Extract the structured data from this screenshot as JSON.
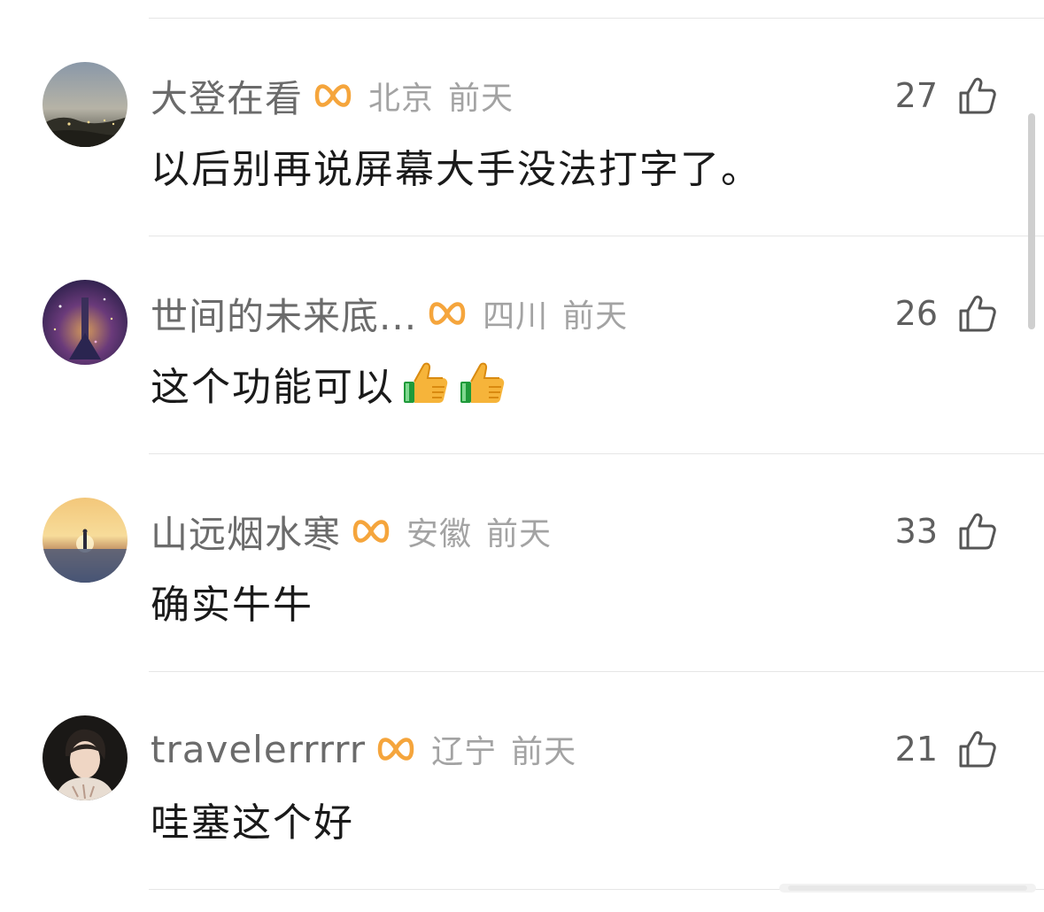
{
  "comments": [
    {
      "username": "大登在看",
      "location": "北京",
      "time": "前天",
      "likes": "27",
      "text": "以后别再说屏幕大手没法打字了。",
      "emoji_count": 0,
      "avatar_icon": "city-night-avatar-icon"
    },
    {
      "username": "世间的未来底...",
      "location": "四川",
      "time": "前天",
      "likes": "26",
      "text": "这个功能可以",
      "emoji_count": 2,
      "avatar_icon": "anime-starry-avatar-icon"
    },
    {
      "username": "山远烟水寒",
      "location": "安徽",
      "time": "前天",
      "likes": "33",
      "text": "确实牛牛",
      "emoji_count": 0,
      "avatar_icon": "sunset-figure-avatar-icon"
    },
    {
      "username": "travelerrrrr",
      "location": "辽宁",
      "time": "前天",
      "likes": "21",
      "text": "哇塞这个好",
      "emoji_count": 0,
      "avatar_icon": "portrait-avatar-icon"
    }
  ],
  "icons": {
    "badge": "orange-infinity-badge-icon",
    "like": "thumbs-up-outline-icon",
    "emoji": "thumbs-up-emoji-icon"
  },
  "colors": {
    "badge": "#f5a53c",
    "username": "#6b6b6b",
    "meta": "#a3a3a3",
    "body": "#1a1a1a",
    "divider": "#e6e6e6"
  }
}
